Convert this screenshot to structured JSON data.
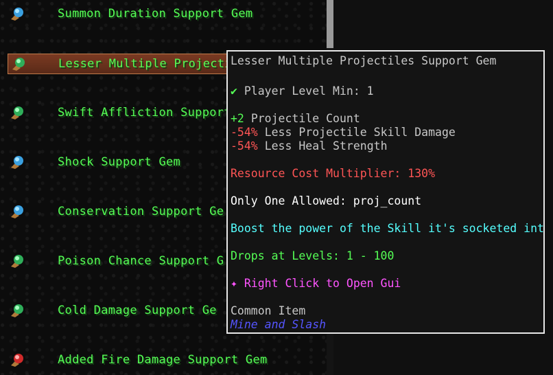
{
  "gem_list": [
    {
      "label": "Summon Duration Support Gem",
      "icon": "blue-gem-icon"
    },
    {
      "label": "Lesser Multiple Projectiles Support Gem",
      "icon": "green-gem-icon",
      "selected": true
    },
    {
      "label": "Swift Affliction Support Gem",
      "icon": "green-gem-icon"
    },
    {
      "label": "Shock Support Gem",
      "icon": "blue-gem-icon"
    },
    {
      "label": "Conservation Support Gem",
      "icon": "blue-gem-icon"
    },
    {
      "label": "Poison Chance Support Gem",
      "icon": "green-gem-icon"
    },
    {
      "label": "Cold Damage Support Gem",
      "icon": "green-gem-icon"
    },
    {
      "label": "Added Fire Damage Support Gem",
      "icon": "red-gem-icon"
    }
  ],
  "list_visible_labels": [
    "Summon Duration Support Gem",
    "Lesser Multiple Projectil",
    "Swift Affliction Support",
    "Shock Support Gem",
    "Conservation Support Ge",
    "Poison Chance Support G",
    "Cold Damage Support Ge",
    "Added Fire Damage Support Gem"
  ],
  "tooltip": {
    "title": "Lesser Multiple Projectiles Support Gem",
    "check_mark": "✔",
    "level_req": "Player Level Min: 1",
    "stat1_value": "+2",
    "stat1_text": "Projectile Count",
    "stat2_value": "-54%",
    "stat2_text": "Less Projectile Skill Damage",
    "stat3_value": "-54%",
    "stat3_text": "Less Heal Strength",
    "resource_cost": "Resource Cost Multiplier: 130%",
    "only_one": "Only One Allowed: proj_count",
    "description": "Boost the power of the Skill it's socketed into.",
    "drops": "Drops at Levels: 1 - 100",
    "right_click_marker": "✦",
    "right_click": "Right Click to Open Gui",
    "rarity": "Common Item",
    "mod_name": "Mine and Slash"
  },
  "colors": {
    "gem_name": "#55ff55",
    "tooltip_border": "#e8e8e8",
    "negative": "#ff5555",
    "description": "#55ffff",
    "action": "#ff55ff",
    "mod": "#5555ff"
  }
}
